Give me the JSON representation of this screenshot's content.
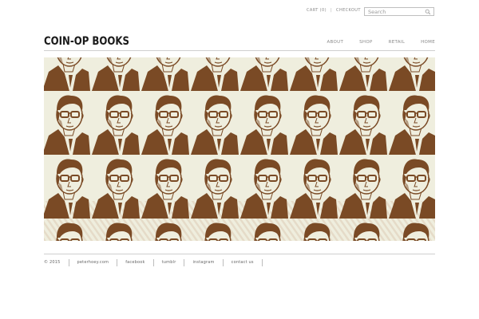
{
  "header": {
    "cart_label": "CART (0)",
    "checkout_label": "CHECKOUT",
    "search_placeholder": "Search",
    "logo": "COIN-OP BOOKS"
  },
  "nav": {
    "items": [
      "ABOUT",
      "SHOP",
      "RETAIL",
      "HOME"
    ]
  },
  "hero": {
    "image_icon": "repeating-portrait-pattern",
    "colors": {
      "background": "#efeede",
      "ink": "#7a4a25",
      "stripe": "#c9a98c"
    }
  },
  "footer": {
    "copyright": "© 2015",
    "links": [
      "peterhoey.com",
      "facebook",
      "tumblr",
      "instagram",
      "contact us"
    ]
  },
  "colors": {
    "text_dark": "#1a1a1a",
    "text_muted": "#8a8a8a",
    "rule": "#cfcfcf"
  }
}
